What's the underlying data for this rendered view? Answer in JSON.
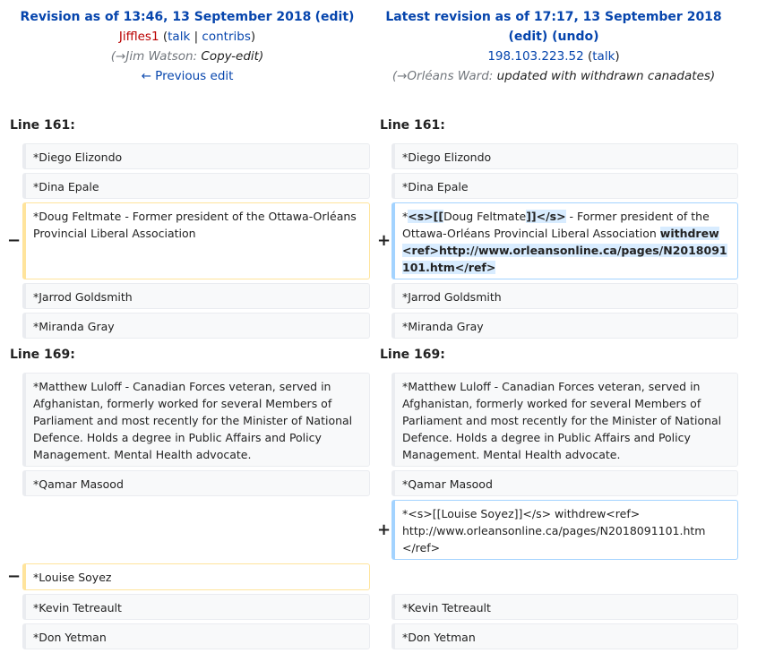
{
  "left_header": {
    "title": "Revision as of 13:46, 13 September 2018",
    "edit": "edit",
    "user": "Jiffles1",
    "talk": "talk",
    "contribs": "contribs",
    "section_arrow": "(→Jim Watson:",
    "summary": "Copy-edit)",
    "previous_edit": "← Previous edit"
  },
  "right_header": {
    "title": "Latest revision as of 17:17, 13 September 2018",
    "edit": "edit",
    "undo": "undo",
    "user": "198.103.223.52",
    "talk": "talk",
    "section_arrow": "(→Orléans Ward:",
    "summary": "updated with withdrawn canadates)"
  },
  "line_labels": {
    "a_left": "Line 161:",
    "a_right": "Line 161:",
    "b_left": "Line 169:",
    "b_right": "Line 169:"
  },
  "markers": {
    "minus": "−",
    "plus": "+"
  },
  "cells": {
    "diego": "*Diego Elizondo",
    "dina": "*Dina Epale",
    "doug_old": "*Doug Feltmate - Former president of the Ottawa-Orléans Provincial Liberal Association",
    "doug_new": {
      "p1": "*",
      "h1": "<s>[[",
      "p2": "Doug Feltmate",
      "h2": "]]</s>",
      "p3": " - Former president of the Ottawa-Orléans Provincial Liberal Association ",
      "h3": "withdrew <ref>http://www.orleansonline.ca/pages/N2018091101.htm</ref>"
    },
    "jarrod": "*Jarrod Goldsmith",
    "miranda": "*Miranda Gray",
    "matthew": "*Matthew Luloff - Canadian Forces veteran, served in Afghanistan, formerly worked for several Members of Parliament and most recently for the Minister of National Defence. Holds a degree in Public Affairs and Policy Management. Mental Health advocate.",
    "qamar": "*Qamar Masood",
    "louise_new": "*<s>[[Louise Soyez]]</s> withdrew<ref> http://www.orleansonline.ca/pages/N2018091101.htm </ref>",
    "louise_old": "*Louise Soyez",
    "kevin": "*Kevin Tetreault",
    "don": "*Don Yetman"
  }
}
